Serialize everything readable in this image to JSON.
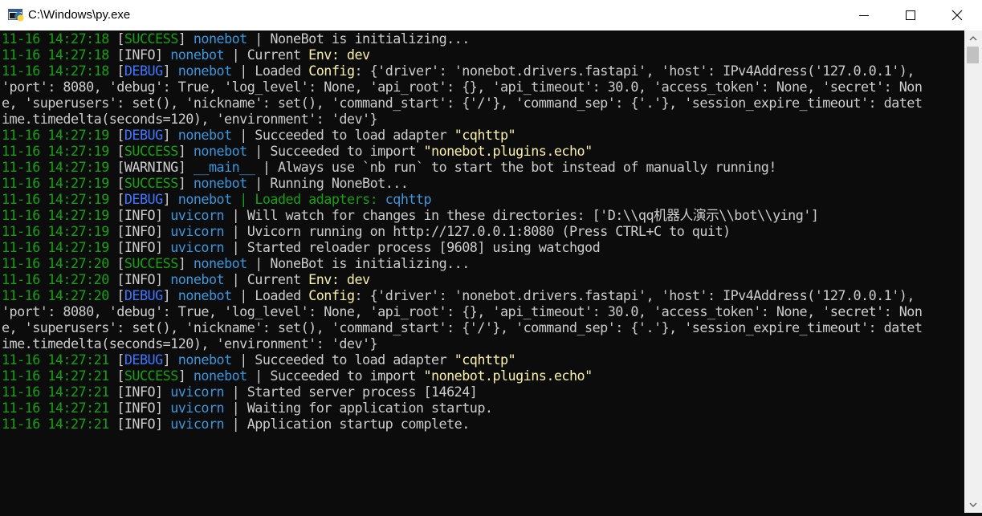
{
  "window": {
    "title": "C:\\Windows\\py.exe"
  },
  "palette": {
    "white": "#cccccc",
    "green": "#13a10e",
    "blue": "#3b78ff",
    "cyan": "#3a96dd",
    "yellow": "#f9f1a5"
  },
  "console": {
    "lines": [
      [
        [
          "11-16 14:27:18 ",
          "green"
        ],
        [
          "[",
          "white"
        ],
        [
          "SUCCESS",
          "green"
        ],
        [
          "] ",
          "white"
        ],
        [
          "nonebot",
          "cyan"
        ],
        [
          " | NoneBot is initializing...",
          "white"
        ]
      ],
      [
        [
          "11-16 14:27:18 ",
          "green"
        ],
        [
          "[INFO] ",
          "white"
        ],
        [
          "nonebot",
          "cyan"
        ],
        [
          " | Current ",
          "white"
        ],
        [
          "Env: dev",
          "yellow"
        ]
      ],
      [
        [
          "11-16 14:27:18 ",
          "green"
        ],
        [
          "[",
          "white"
        ],
        [
          "DEBUG",
          "blue"
        ],
        [
          "] ",
          "white"
        ],
        [
          "nonebot",
          "cyan"
        ],
        [
          " | Loaded ",
          "white"
        ],
        [
          "Config",
          "yellow"
        ],
        [
          ": {'driver': 'nonebot.drivers.fastapi', 'host': IPv4Address('127.0.0.1'),",
          "white"
        ]
      ],
      [
        [
          "'port': 8080, 'debug': True, 'log_level': None, 'api_root': {}, 'api_timeout': 30.0, 'access_token': None, 'secret': Non",
          "white"
        ]
      ],
      [
        [
          "e, 'superusers': set(), 'nickname': set(), 'command_start': {'/'}, 'command_sep': {'.'}, 'session_expire_timeout': datet",
          "white"
        ]
      ],
      [
        [
          "ime.timedelta(seconds=120), 'environment': 'dev'}",
          "white"
        ]
      ],
      [
        [
          "11-16 14:27:19 ",
          "green"
        ],
        [
          "[",
          "white"
        ],
        [
          "DEBUG",
          "blue"
        ],
        [
          "] ",
          "white"
        ],
        [
          "nonebot",
          "cyan"
        ],
        [
          " | Succeeded to load adapter ",
          "white"
        ],
        [
          "\"cqhttp\"",
          "yellow"
        ]
      ],
      [
        [
          "11-16 14:27:19 ",
          "green"
        ],
        [
          "[",
          "white"
        ],
        [
          "SUCCESS",
          "green"
        ],
        [
          "] ",
          "white"
        ],
        [
          "nonebot",
          "cyan"
        ],
        [
          " | Succeeded to import ",
          "white"
        ],
        [
          "\"nonebot.plugins.echo\"",
          "yellow"
        ]
      ],
      [
        [
          "11-16 14:27:19 ",
          "green"
        ],
        [
          "[WARNING] ",
          "white"
        ],
        [
          "__main__",
          "cyan"
        ],
        [
          " | Always use `nb run` to start the bot instead of manually running!",
          "white"
        ]
      ],
      [
        [
          "11-16 14:27:19 ",
          "green"
        ],
        [
          "[",
          "white"
        ],
        [
          "SUCCESS",
          "green"
        ],
        [
          "] ",
          "white"
        ],
        [
          "nonebot",
          "cyan"
        ],
        [
          " | Running NoneBot...",
          "white"
        ]
      ],
      [
        [
          "11-16 14:27:19 ",
          "green"
        ],
        [
          "[",
          "white"
        ],
        [
          "DEBUG",
          "blue"
        ],
        [
          "] ",
          "white"
        ],
        [
          "nonebot",
          "cyan"
        ],
        [
          " | ",
          "green"
        ],
        [
          "Loaded adapters: ",
          "green"
        ],
        [
          "cqhttp",
          "cyan"
        ]
      ],
      [
        [
          "11-16 14:27:19 ",
          "green"
        ],
        [
          "[INFO] ",
          "white"
        ],
        [
          "uvicorn",
          "cyan"
        ],
        [
          " | Will watch for changes in these directories: ['D:\\\\qq机器人演示\\\\bot\\\\ying']",
          "white"
        ]
      ],
      [
        [
          "11-16 14:27:19 ",
          "green"
        ],
        [
          "[INFO] ",
          "white"
        ],
        [
          "uvicorn",
          "cyan"
        ],
        [
          " | Uvicorn running on http://127.0.0.1:8080 (Press CTRL+C to quit)",
          "white"
        ]
      ],
      [
        [
          "11-16 14:27:19 ",
          "green"
        ],
        [
          "[INFO] ",
          "white"
        ],
        [
          "uvicorn",
          "cyan"
        ],
        [
          " | Started reloader process [9608] using watchgod",
          "white"
        ]
      ],
      [
        [
          "11-16 14:27:20 ",
          "green"
        ],
        [
          "[",
          "white"
        ],
        [
          "SUCCESS",
          "green"
        ],
        [
          "] ",
          "white"
        ],
        [
          "nonebot",
          "cyan"
        ],
        [
          " | NoneBot is initializing...",
          "white"
        ]
      ],
      [
        [
          "11-16 14:27:20 ",
          "green"
        ],
        [
          "[INFO] ",
          "white"
        ],
        [
          "nonebot",
          "cyan"
        ],
        [
          " | Current ",
          "white"
        ],
        [
          "Env: dev",
          "yellow"
        ]
      ],
      [
        [
          "11-16 14:27:20 ",
          "green"
        ],
        [
          "[",
          "white"
        ],
        [
          "DEBUG",
          "blue"
        ],
        [
          "] ",
          "white"
        ],
        [
          "nonebot",
          "cyan"
        ],
        [
          " | Loaded ",
          "white"
        ],
        [
          "Config",
          "yellow"
        ],
        [
          ": {'driver': 'nonebot.drivers.fastapi', 'host': IPv4Address('127.0.0.1'),",
          "white"
        ]
      ],
      [
        [
          "'port': 8080, 'debug': True, 'log_level': None, 'api_root': {}, 'api_timeout': 30.0, 'access_token': None, 'secret': Non",
          "white"
        ]
      ],
      [
        [
          "e, 'superusers': set(), 'nickname': set(), 'command_start': {'/'}, 'command_sep': {'.'}, 'session_expire_timeout': datet",
          "white"
        ]
      ],
      [
        [
          "ime.timedelta(seconds=120), 'environment': 'dev'}",
          "white"
        ]
      ],
      [
        [
          "11-16 14:27:21 ",
          "green"
        ],
        [
          "[",
          "white"
        ],
        [
          "DEBUG",
          "blue"
        ],
        [
          "] ",
          "white"
        ],
        [
          "nonebot",
          "cyan"
        ],
        [
          " | Succeeded to load adapter ",
          "white"
        ],
        [
          "\"cqhttp\"",
          "yellow"
        ]
      ],
      [
        [
          "11-16 14:27:21 ",
          "green"
        ],
        [
          "[",
          "white"
        ],
        [
          "SUCCESS",
          "green"
        ],
        [
          "] ",
          "white"
        ],
        [
          "nonebot",
          "cyan"
        ],
        [
          " | Succeeded to import ",
          "white"
        ],
        [
          "\"nonebot.plugins.echo\"",
          "yellow"
        ]
      ],
      [
        [
          "11-16 14:27:21 ",
          "green"
        ],
        [
          "[INFO] ",
          "white"
        ],
        [
          "uvicorn",
          "cyan"
        ],
        [
          " | Started server process [14624]",
          "white"
        ]
      ],
      [
        [
          "11-16 14:27:21 ",
          "green"
        ],
        [
          "[INFO] ",
          "white"
        ],
        [
          "uvicorn",
          "cyan"
        ],
        [
          " | Waiting for application startup.",
          "white"
        ]
      ],
      [
        [
          "11-16 14:27:21 ",
          "green"
        ],
        [
          "[INFO] ",
          "white"
        ],
        [
          "uvicorn",
          "cyan"
        ],
        [
          " | Application startup complete.",
          "white"
        ]
      ]
    ]
  }
}
